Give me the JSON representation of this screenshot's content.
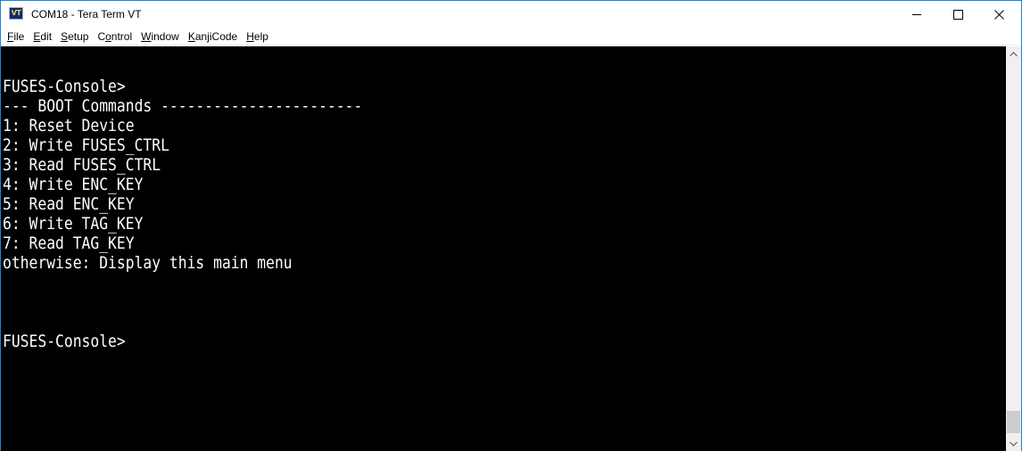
{
  "window": {
    "title": "COM18 - Tera Term VT",
    "icon_label": "VT",
    "controls": {
      "minimize": "minimize",
      "maximize": "maximize",
      "close": "close"
    }
  },
  "menu": [
    {
      "accel": "F",
      "rest": "ile"
    },
    {
      "accel": "E",
      "rest": "dit"
    },
    {
      "accel": "S",
      "rest": "etup"
    },
    {
      "pre": "C",
      "accel": "o",
      "rest": "ntrol"
    },
    {
      "accel": "W",
      "rest": "indow"
    },
    {
      "accel": "K",
      "rest": "anjiCode"
    },
    {
      "accel": "H",
      "rest": "elp"
    }
  ],
  "terminal": {
    "lines": [
      "FUSES-Console>",
      "--- BOOT Commands -----------------------",
      "1: Reset Device",
      "2: Write FUSES_CTRL",
      "3: Read FUSES_CTRL",
      "4: Write ENC_KEY",
      "5: Read ENC_KEY",
      "6: Write TAG_KEY",
      "7: Read TAG_KEY",
      "otherwise: Display this main menu",
      "",
      "",
      "",
      "FUSES-Console>"
    ],
    "foreground": "#ffffff",
    "background": "#000000"
  },
  "scrollbar": {
    "up_icon": "chevron-up-icon",
    "down_icon": "chevron-down-icon",
    "position": 1.0
  },
  "colors": {
    "window_border": "#1883d7",
    "scrollbar_track": "#f0f0f0",
    "scrollbar_thumb": "#cdcdcd"
  }
}
